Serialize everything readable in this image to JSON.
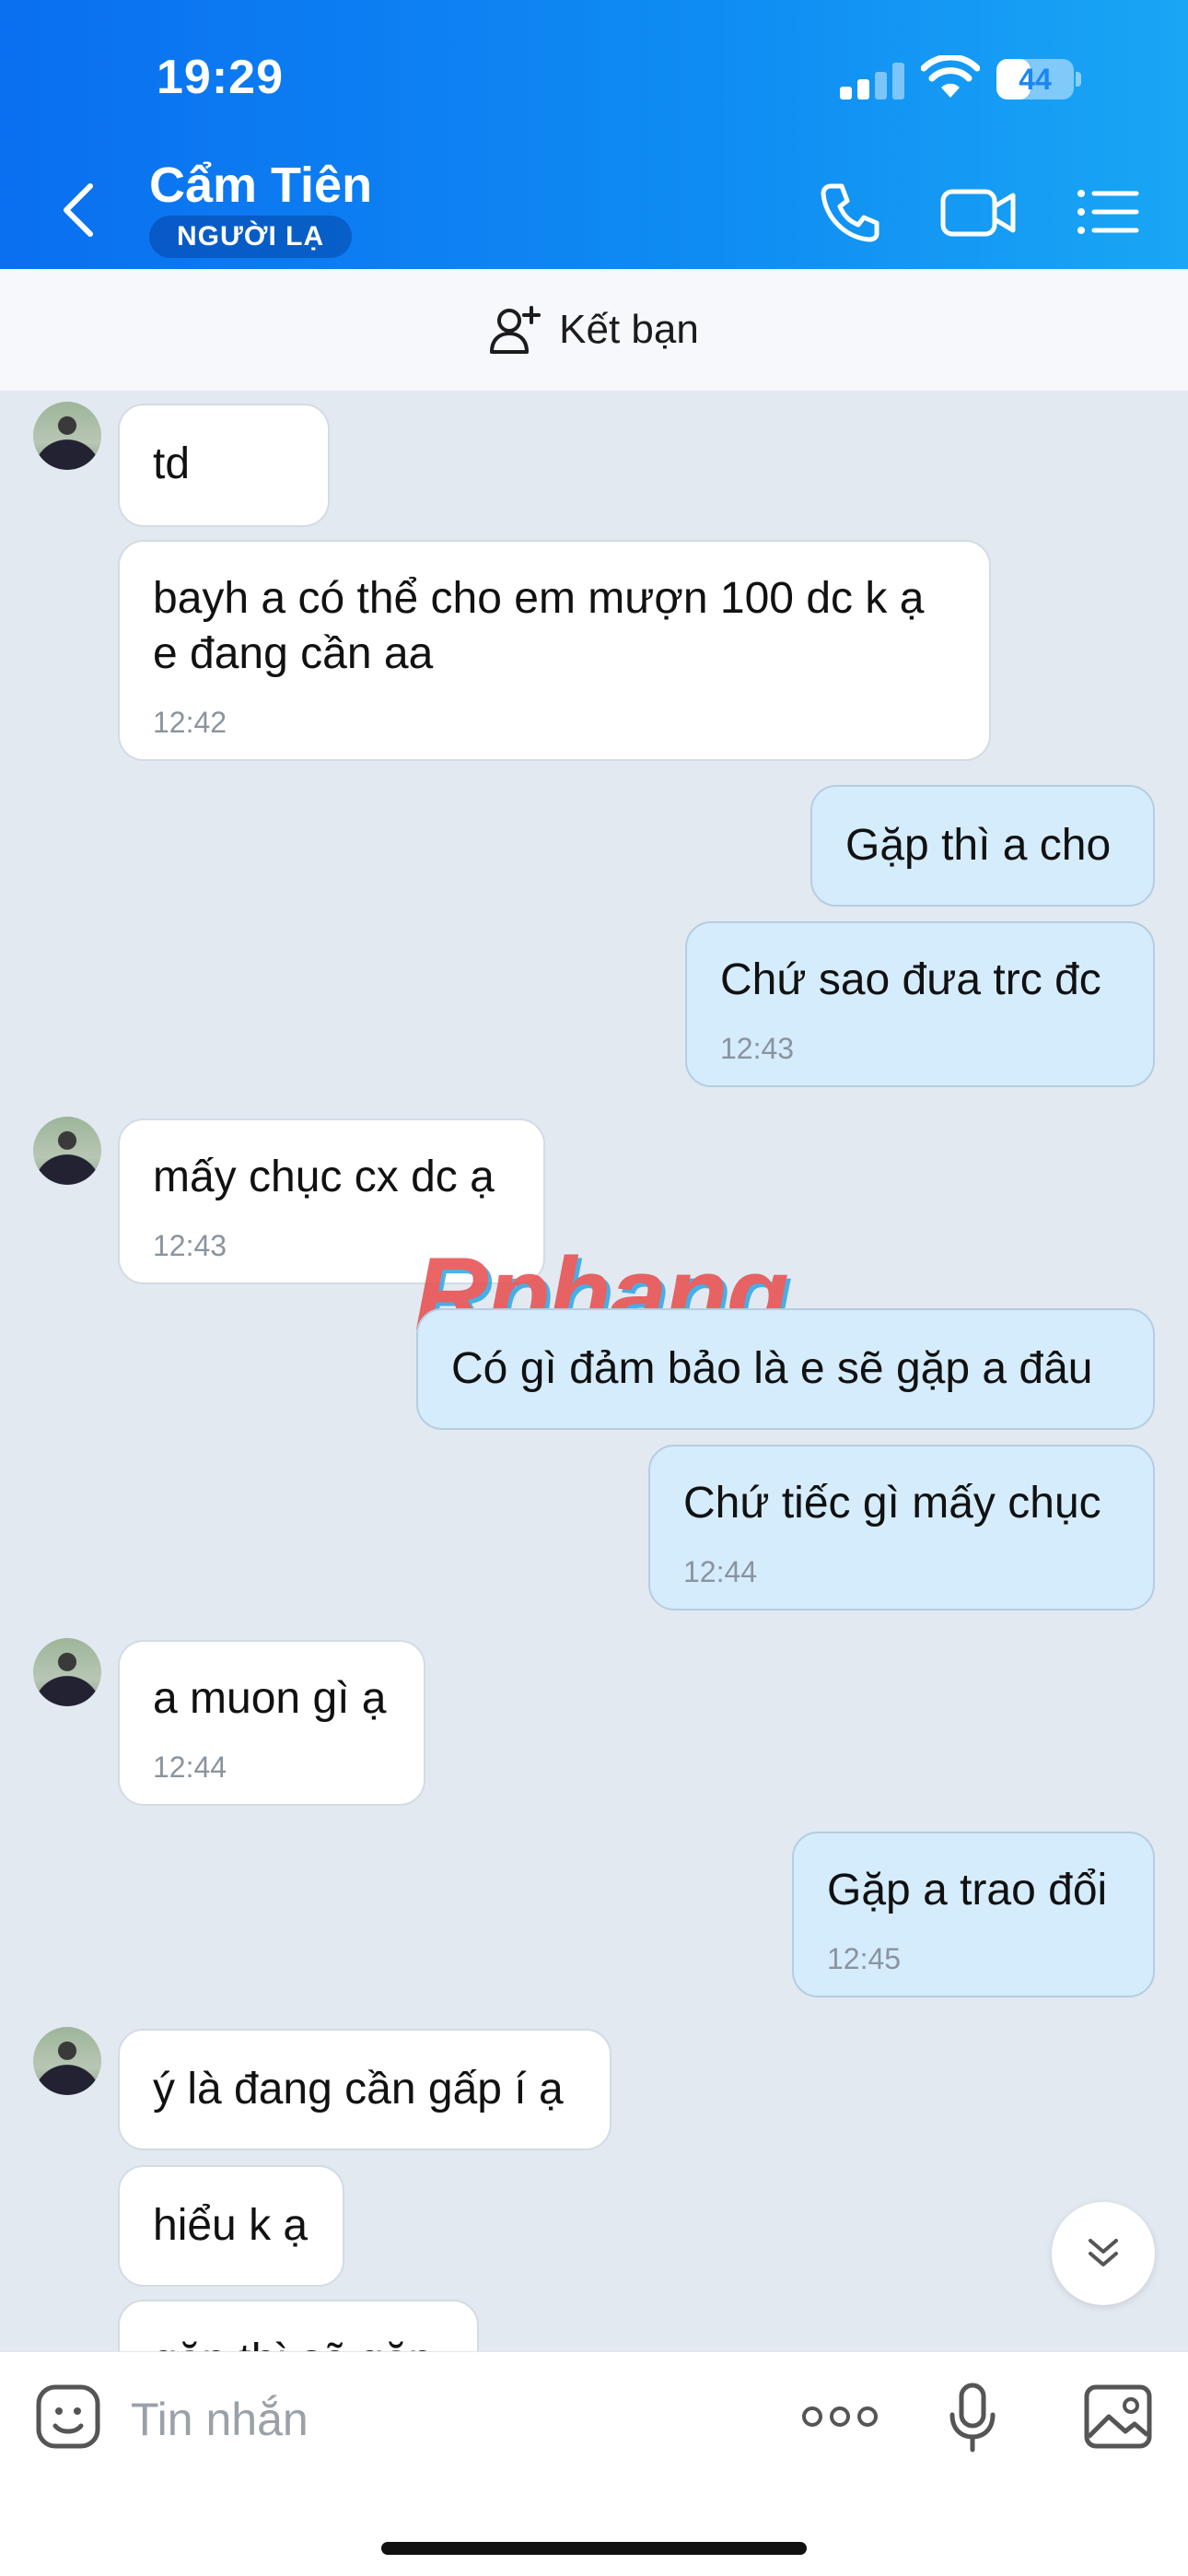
{
  "status_bar": {
    "time": "19:29",
    "battery": "44",
    "battery_level": 0.44
  },
  "header": {
    "contact_name": "Cẩm Tiên",
    "badge": "NGƯỜI LẠ"
  },
  "add_friend": {
    "label": "Kết bạn"
  },
  "watermark": "Rphang",
  "messages": [
    {
      "dir": "in",
      "text": "td",
      "time": ""
    },
    {
      "dir": "in",
      "text": "bayh a có thể cho em mượn 100 dc k ạ",
      "text2": "e đang cần aa",
      "time": "12:42"
    },
    {
      "dir": "out",
      "text": "Gặp thì a cho",
      "time": ""
    },
    {
      "dir": "out",
      "text": "Chứ sao đưa trc đc",
      "time": "12:43"
    },
    {
      "dir": "in",
      "text": "mấy chục cx dc ạ",
      "time": "12:43"
    },
    {
      "dir": "out",
      "text": "Có gì đảm bảo là e sẽ gặp a đâu",
      "time": ""
    },
    {
      "dir": "out",
      "text": "Chứ tiếc gì mấy chục",
      "time": "12:44"
    },
    {
      "dir": "in",
      "text": "a muon gì ạ",
      "time": "12:44"
    },
    {
      "dir": "out",
      "text": "Gặp a trao đổi",
      "time": "12:45"
    },
    {
      "dir": "in",
      "text": "ý là đang cần gấp í ạ",
      "time": ""
    },
    {
      "dir": "in",
      "text": "hiểu k ạ",
      "time": ""
    },
    {
      "dir": "in",
      "text": "gặp thì sẽ gặp",
      "time": ""
    }
  ],
  "composer": {
    "placeholder": "Tin nhắn"
  },
  "colors": {
    "header_start": "#0a6ff0",
    "header_end": "#19a6f4",
    "outgoing_bubble": "#d5ecfd",
    "incoming_bubble": "#ffffff",
    "chat_bg": "#e2e9f1"
  },
  "icons": [
    "back-icon",
    "phone-icon",
    "video-icon",
    "menu-list-icon",
    "add-friend-icon",
    "sticker-icon",
    "more-icon",
    "microphone-icon",
    "image-icon",
    "chevron-double-down-icon"
  ]
}
